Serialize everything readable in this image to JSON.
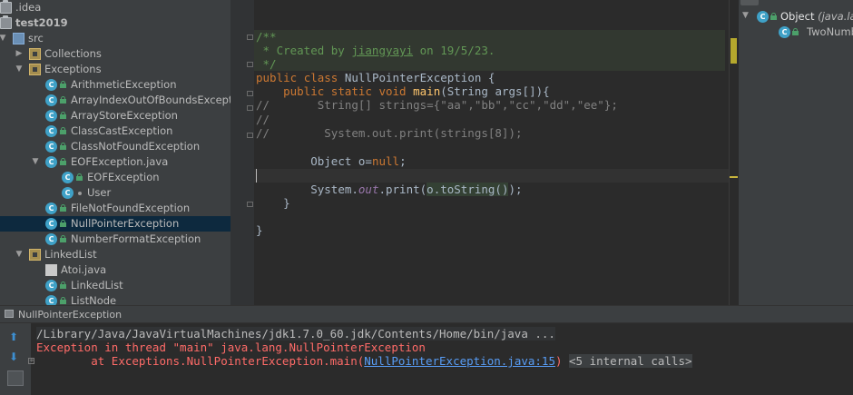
{
  "project_tree": [
    {
      "label": ".idea",
      "icon": "idea-folder-icon",
      "indent": 0,
      "arrow": "",
      "type": "folder"
    },
    {
      "label": "test2019",
      "icon": "module-folder-icon",
      "indent": 0,
      "arrow": "",
      "type": "folder",
      "bold": true
    },
    {
      "label": "src",
      "icon": "source-folder-icon",
      "indent": 1,
      "arrow": "▼",
      "type": "src"
    },
    {
      "label": "Collections",
      "icon": "package-icon",
      "indent": 2,
      "arrow": "▶",
      "type": "pkg"
    },
    {
      "label": "Exceptions",
      "icon": "package-icon",
      "indent": 2,
      "arrow": "▼",
      "type": "pkg"
    },
    {
      "label": "ArithmeticException",
      "icon": "class-icon",
      "indent": 3,
      "arrow": "",
      "type": "class"
    },
    {
      "label": "ArrayIndexOutOfBoundsException",
      "icon": "class-icon",
      "indent": 3,
      "arrow": "",
      "type": "class"
    },
    {
      "label": "ArrayStoreException",
      "icon": "class-icon",
      "indent": 3,
      "arrow": "",
      "type": "class"
    },
    {
      "label": "ClassCastException",
      "icon": "class-icon",
      "indent": 3,
      "arrow": "",
      "type": "class"
    },
    {
      "label": "ClassNotFoundException",
      "icon": "class-icon",
      "indent": 3,
      "arrow": "",
      "type": "class"
    },
    {
      "label": "EOFException.java",
      "icon": "java-file-icon",
      "indent": 3,
      "arrow": "▼",
      "type": "class"
    },
    {
      "label": "EOFException",
      "icon": "class-icon",
      "indent": 4,
      "arrow": "",
      "type": "class"
    },
    {
      "label": "User",
      "icon": "class-icon",
      "indent": 4,
      "arrow": "",
      "type": "class-dot"
    },
    {
      "label": "FileNotFoundException",
      "icon": "class-icon",
      "indent": 3,
      "arrow": "",
      "type": "class"
    },
    {
      "label": "NullPointerException",
      "icon": "class-icon",
      "indent": 3,
      "arrow": "",
      "type": "class",
      "selected": true
    },
    {
      "label": "NumberFormatException",
      "icon": "class-icon",
      "indent": 3,
      "arrow": "",
      "type": "class"
    },
    {
      "label": "LinkedList",
      "icon": "package-icon",
      "indent": 2,
      "arrow": "▼",
      "type": "pkg"
    },
    {
      "label": "Atoi.java",
      "icon": "java-file-icon",
      "indent": 3,
      "arrow": "",
      "type": "file"
    },
    {
      "label": "LinkedList",
      "icon": "class-icon",
      "indent": 3,
      "arrow": "",
      "type": "class"
    },
    {
      "label": "ListNode",
      "icon": "class-icon",
      "indent": 3,
      "arrow": "",
      "type": "class"
    }
  ],
  "editor": {
    "doc_open": "/**",
    "doc_created": " * Created by ",
    "doc_author": "jiangyayi",
    "doc_on": " on 19/5/23.",
    "doc_close": " */",
    "kw_public": "public",
    "kw_class": "class",
    "kw_static": "static",
    "kw_void": "void",
    "class_name": "NullPointerException",
    "brace_open": " {",
    "main_name": "main",
    "main_params": "(String args[]){",
    "comment1": "//       String[] strings={\"aa\",\"bb\",\"cc\",\"dd\",\"ee\"};",
    "comment2": "//",
    "comment3": "//        System.out.print(strings[8]);",
    "obj_decl": "Object o=",
    "kw_null": "null",
    "semicolon": ";",
    "sys": "System.",
    "out": "out",
    "print_call": ".print(",
    "to_string": "o.toString()",
    "close_call": ");",
    "close_brace_inner": "}",
    "close_brace_outer": "}"
  },
  "structure": {
    "root_label": "Object",
    "root_pkg": "(java.la",
    "child_label": "TwoNumb"
  },
  "run": {
    "tab_title": "NullPointerException",
    "cmd_line": "/Library/Java/JavaVirtualMachines/jdk1.7.0_60.jdk/Contents/Home/bin/java ...",
    "exception_line": "Exception in thread \"main\" java.lang.NullPointerException",
    "at_prefix": "\tat Exceptions.NullPointerException.main(",
    "link": "NullPointerException.java:15",
    "at_suffix": ")",
    "internal_calls": "<5 internal calls>"
  },
  "colors": {
    "keyword": "#cc7832",
    "doc_comment": "#629755",
    "error_text": "#ff6b68",
    "link": "#589df6"
  }
}
